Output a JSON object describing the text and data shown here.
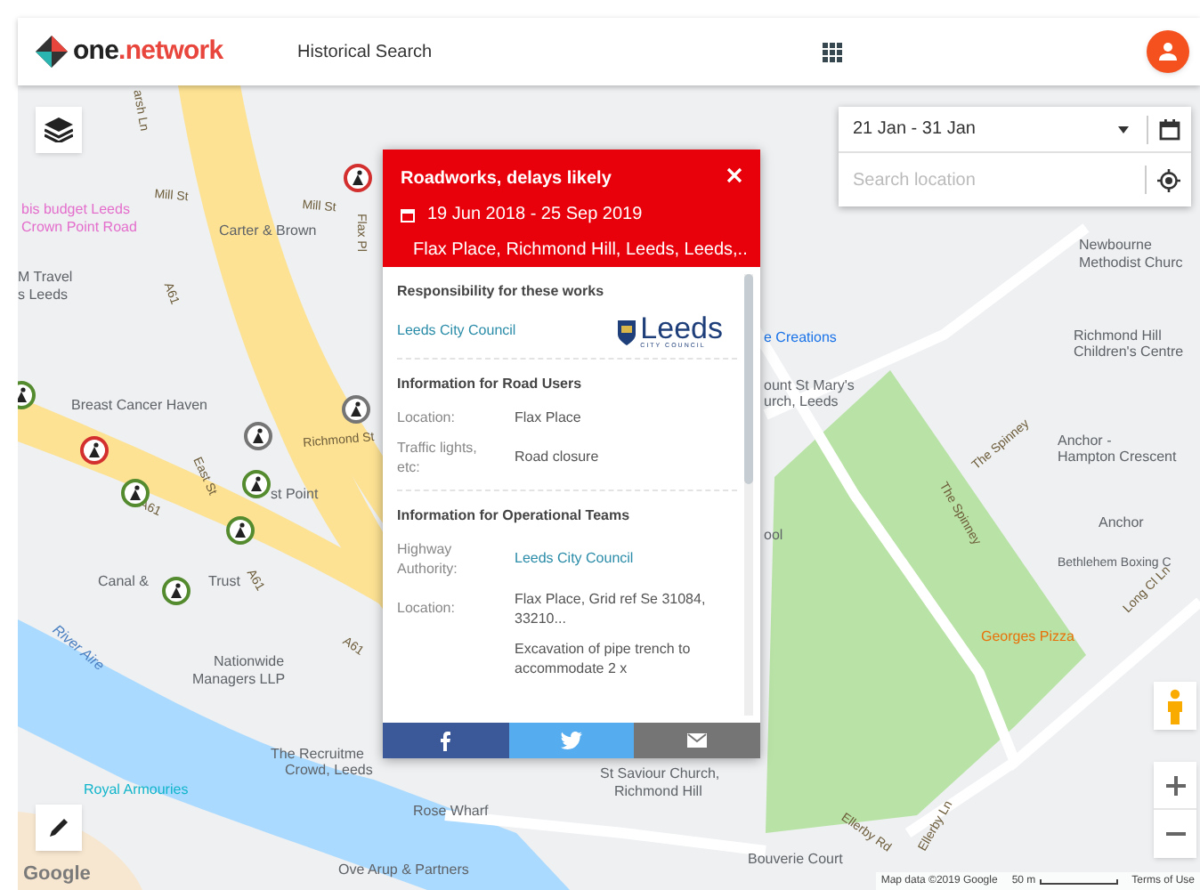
{
  "header": {
    "logo": {
      "prefix": "one",
      "dot": ".",
      "suffix": "network"
    },
    "title": "Historical Search"
  },
  "map": {
    "labels": [
      {
        "text": "arsh Ln",
        "kind": "road"
      },
      {
        "text": "Mill St",
        "kind": "road"
      },
      {
        "text": "Mill St",
        "kind": "road"
      },
      {
        "text": "Flax Pl",
        "kind": "road"
      },
      {
        "text": "bis budget Leeds",
        "kind": "hotel"
      },
      {
        "text": "Crown Point Road",
        "kind": "hotel"
      },
      {
        "text": "Carter & Brown",
        "kind": "place"
      },
      {
        "text": "M Travel",
        "kind": "place"
      },
      {
        "text": "s Leeds",
        "kind": "place"
      },
      {
        "text": "A61",
        "kind": "road"
      },
      {
        "text": "Breast Cancer Haven",
        "kind": "place"
      },
      {
        "text": "Richmond St",
        "kind": "road"
      },
      {
        "text": "East St",
        "kind": "road"
      },
      {
        "text": "st Point",
        "kind": "place"
      },
      {
        "text": "A61",
        "kind": "road"
      },
      {
        "text": "Canal &",
        "kind": "place"
      },
      {
        "text": "Trust",
        "kind": "place"
      },
      {
        "text": "A61",
        "kind": "road"
      },
      {
        "text": "Nationwide",
        "kind": "place"
      },
      {
        "text": "Managers LLP",
        "kind": "place"
      },
      {
        "text": "River Aire",
        "kind": "water"
      },
      {
        "text": "A61",
        "kind": "road"
      },
      {
        "text": "The Recruitme",
        "kind": "place"
      },
      {
        "text": "Crowd, Leeds",
        "kind": "place"
      },
      {
        "text": "Royal Armouries",
        "kind": "museum"
      },
      {
        "text": "Rose Wharf",
        "kind": "place"
      },
      {
        "text": "St Saviour Church,",
        "kind": "place"
      },
      {
        "text": "Richmond Hill",
        "kind": "place"
      },
      {
        "text": "Ove Arup & Partners",
        "kind": "place"
      },
      {
        "text": "Bouverie Court",
        "kind": "place"
      },
      {
        "text": "Newbourne",
        "kind": "place"
      },
      {
        "text": "Methodist Churc",
        "kind": "place"
      },
      {
        "text": "e Creations",
        "kind": "shop"
      },
      {
        "text": "Richmond Hill",
        "kind": "place"
      },
      {
        "text": "Children's Centre",
        "kind": "place"
      },
      {
        "text": "ount St Mary's",
        "kind": "place"
      },
      {
        "text": "urch, Leeds",
        "kind": "place"
      },
      {
        "text": "The Spinney",
        "kind": "road"
      },
      {
        "text": "Anchor -",
        "kind": "place"
      },
      {
        "text": "Hampton Crescent",
        "kind": "place"
      },
      {
        "text": "Anchor",
        "kind": "place"
      },
      {
        "text": "The Spinney",
        "kind": "road"
      },
      {
        "text": "ool",
        "kind": "place"
      },
      {
        "text": "Bethlehem Boxing C",
        "kind": "place"
      },
      {
        "text": "Long Cl Ln",
        "kind": "road"
      },
      {
        "text": "Georges Pizza",
        "kind": "food"
      },
      {
        "text": "Ellerby Rd",
        "kind": "road"
      },
      {
        "text": "Ellerby Ln",
        "kind": "road"
      },
      {
        "text": "Google",
        "kind": "brand"
      }
    ],
    "markers": [
      {
        "color": "#d32f2f"
      },
      {
        "color": "#757575"
      },
      {
        "color": "#757575"
      },
      {
        "color": "#d32f2f"
      },
      {
        "color": "#558b2f"
      },
      {
        "color": "#558b2f"
      },
      {
        "color": "#558b2f"
      },
      {
        "color": "#558b2f"
      },
      {
        "color": "#558b2f"
      }
    ],
    "attribution": {
      "data": "Map data ©2019 Google",
      "scale": "50 m",
      "terms": "Terms of Use"
    }
  },
  "date_filter": {
    "value": "21 Jan - 31 Jan"
  },
  "location_search": {
    "placeholder": "Search location"
  },
  "popup": {
    "title": "Roadworks, delays likely",
    "dates": "19 Jun 2018 - 25 Sep 2019",
    "address": "Flax Place, Richmond Hill, Leeds, Leeds,..",
    "responsibility": {
      "heading": "Responsibility for these works",
      "authority": "Leeds City Council",
      "logo_text": "Leeds",
      "logo_subtext": "CITY COUNCIL"
    },
    "sections": [
      {
        "heading": "Information for Road Users",
        "rows": [
          {
            "label": "Location:",
            "value": "Flax Place",
            "kind": "text"
          },
          {
            "label": "Traffic lights, etc:",
            "value": "Road closure",
            "kind": "text"
          }
        ]
      },
      {
        "heading": "Information for Operational Teams",
        "rows": [
          {
            "label": "Highway Authority:",
            "value": "Leeds City Council",
            "kind": "link"
          },
          {
            "label": "Location:",
            "value": "Flax Place, Grid ref Se 31084, 33210...",
            "kind": "text"
          },
          {
            "label": "",
            "value": "Excavation of pipe trench to accommodate 2 x",
            "kind": "text"
          }
        ]
      }
    ],
    "share": [
      {
        "kind": "facebook"
      },
      {
        "kind": "twitter"
      },
      {
        "kind": "email"
      }
    ]
  }
}
